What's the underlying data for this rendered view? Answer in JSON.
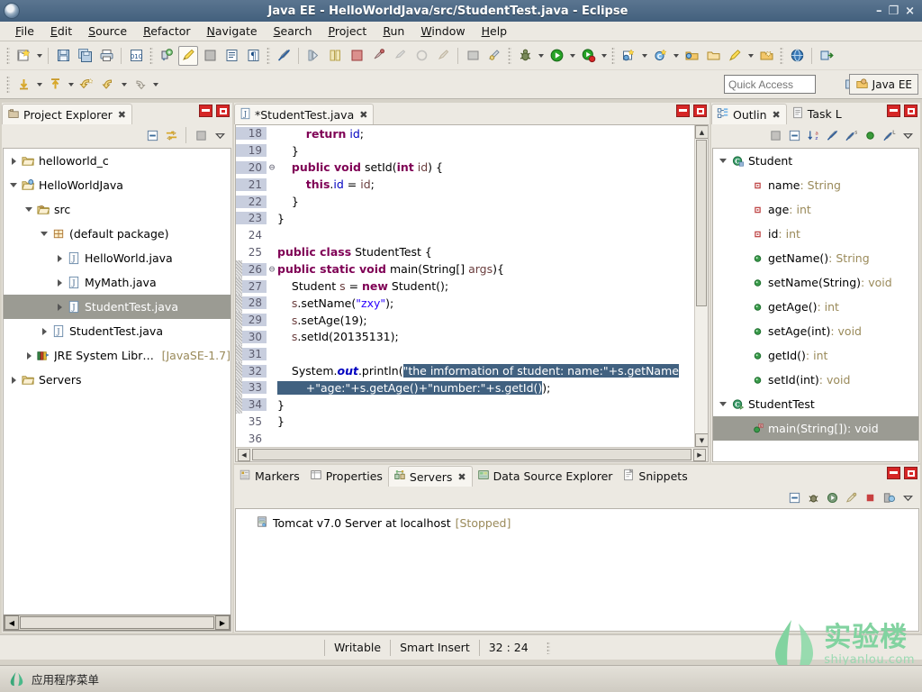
{
  "window": {
    "title": "Java EE - HelloWorldJava/src/StudentTest.java - Eclipse",
    "minimize": "–",
    "restore": "❐",
    "close": "×",
    "app_icon": "eclipse-icon"
  },
  "menubar": {
    "items": [
      {
        "label": "File"
      },
      {
        "label": "Edit"
      },
      {
        "label": "Source"
      },
      {
        "label": "Refactor"
      },
      {
        "label": "Navigate"
      },
      {
        "label": "Search"
      },
      {
        "label": "Project"
      },
      {
        "label": "Run"
      },
      {
        "label": "Window"
      },
      {
        "label": "Help"
      }
    ]
  },
  "toolbar": {
    "quick_access_placeholder": "Quick Access",
    "perspective_label": "Java EE",
    "open_perspective_icon": "open-perspective-icon",
    "row1_icons": [
      "new-wizard-icon",
      "new-dropdown-icon",
      "save-icon",
      "save-all-icon",
      "print-icon",
      "toggle-breadcrumb-icon",
      "new-jsp-icon",
      "link-icon",
      "markers-icon",
      "show-whitespace-icon",
      "paragraph-icon",
      "skip-breakpoints-icon",
      "step-icon",
      "toggle-icon",
      "block-icon",
      "search-icon",
      "history-icon",
      "refresh-icon",
      "open-type-icon",
      "open-task-icon",
      "debug-icon",
      "run-icon",
      "run-last-icon",
      "new-java-project-icon",
      "new-class-icon",
      "open-folder-icon",
      "open-resource-icon",
      "pin-icon",
      "external-tools-icon",
      "web-browser-icon",
      "deploy-icon"
    ],
    "row2_icons": [
      "next-annotation-icon",
      "previous-annotation-icon",
      "back-icon",
      "forward-icon",
      "last-edit-icon"
    ]
  },
  "project_explorer": {
    "tab_label": "Project Explorer",
    "tab_icon": "project-explorer-icon",
    "close_glyph": "✖",
    "toolbar_icons": [
      "collapse-all-icon",
      "link-with-editor-icon",
      "view-menu-grid-icon",
      "view-menu-icon"
    ],
    "tree": [
      {
        "label": "helloworld_c",
        "indent": 0,
        "twisty": "collapsed",
        "icon": "project-folder-icon",
        "selected": false,
        "suffix": ""
      },
      {
        "label": "HelloWorldJava",
        "indent": 0,
        "twisty": "expanded",
        "icon": "java-project-icon",
        "selected": false,
        "suffix": ""
      },
      {
        "label": "src",
        "indent": 1,
        "twisty": "expanded",
        "icon": "source-folder-icon",
        "selected": false,
        "suffix": ""
      },
      {
        "label": "(default package)",
        "indent": 2,
        "twisty": "expanded",
        "icon": "package-icon",
        "selected": false,
        "suffix": ""
      },
      {
        "label": "HelloWorld.java",
        "indent": 3,
        "twisty": "collapsed",
        "icon": "java-file-icon",
        "selected": false,
        "suffix": ""
      },
      {
        "label": "MyMath.java",
        "indent": 3,
        "twisty": "collapsed",
        "icon": "java-file-icon",
        "selected": false,
        "suffix": ""
      },
      {
        "label": "StudentTest.java",
        "indent": 3,
        "twisty": "collapsed",
        "icon": "java-file-icon",
        "selected": true,
        "suffix": ""
      },
      {
        "label": "StudentTest.java",
        "indent": 2,
        "twisty": "collapsed",
        "icon": "java-file-icon",
        "selected": false,
        "suffix": ""
      },
      {
        "label": "JRE System Library",
        "indent": 1,
        "twisty": "collapsed",
        "icon": "jre-library-icon",
        "selected": false,
        "suffix": "[JavaSE-1.7]"
      },
      {
        "label": "Servers",
        "indent": 0,
        "twisty": "collapsed",
        "icon": "project-folder-icon",
        "selected": false,
        "suffix": ""
      }
    ]
  },
  "editor": {
    "tab_label": "*StudentTest.java",
    "tab_icon": "java-file-icon",
    "close_glyph": "✖",
    "first_line": 18,
    "lines": [
      {
        "n": 18,
        "fold": "",
        "marker": false,
        "ln_hl": true,
        "segs": [
          {
            "t": "        ",
            "c": "plain"
          },
          {
            "t": "return",
            "c": "kw"
          },
          {
            "t": " ",
            "c": "plain"
          },
          {
            "t": "id",
            "c": "fld"
          },
          {
            "t": ";",
            "c": "plain"
          }
        ]
      },
      {
        "n": 19,
        "fold": "",
        "marker": false,
        "ln_hl": true,
        "segs": [
          {
            "t": "    }",
            "c": "plain"
          }
        ]
      },
      {
        "n": 20,
        "fold": "⊖",
        "marker": false,
        "ln_hl": true,
        "segs": [
          {
            "t": "    ",
            "c": "plain"
          },
          {
            "t": "public void",
            "c": "kw"
          },
          {
            "t": " setId(",
            "c": "plain"
          },
          {
            "t": "int",
            "c": "kw"
          },
          {
            "t": " ",
            "c": "plain"
          },
          {
            "t": "id",
            "c": "var"
          },
          {
            "t": ") {",
            "c": "plain"
          }
        ]
      },
      {
        "n": 21,
        "fold": "",
        "marker": false,
        "ln_hl": true,
        "segs": [
          {
            "t": "        ",
            "c": "plain"
          },
          {
            "t": "this",
            "c": "kw"
          },
          {
            "t": ".",
            "c": "plain"
          },
          {
            "t": "id",
            "c": "fld"
          },
          {
            "t": " = ",
            "c": "plain"
          },
          {
            "t": "id",
            "c": "var"
          },
          {
            "t": ";",
            "c": "plain"
          }
        ]
      },
      {
        "n": 22,
        "fold": "",
        "marker": false,
        "ln_hl": true,
        "segs": [
          {
            "t": "    }",
            "c": "plain"
          }
        ]
      },
      {
        "n": 23,
        "fold": "",
        "marker": false,
        "ln_hl": true,
        "segs": [
          {
            "t": "}",
            "c": "plain"
          }
        ]
      },
      {
        "n": 24,
        "fold": "",
        "marker": false,
        "ln_hl": false,
        "segs": [
          {
            "t": "",
            "c": "plain"
          }
        ]
      },
      {
        "n": 25,
        "fold": "",
        "marker": false,
        "ln_hl": false,
        "segs": [
          {
            "t": "public class",
            "c": "kw"
          },
          {
            "t": " StudentTest {",
            "c": "plain"
          }
        ]
      },
      {
        "n": 26,
        "fold": "⊖",
        "marker": true,
        "ln_hl": true,
        "segs": [
          {
            "t": "public static void",
            "c": "kw"
          },
          {
            "t": " main(String[] ",
            "c": "plain"
          },
          {
            "t": "args",
            "c": "var"
          },
          {
            "t": "){",
            "c": "plain"
          }
        ]
      },
      {
        "n": 27,
        "fold": "",
        "marker": true,
        "ln_hl": true,
        "segs": [
          {
            "t": "    Student ",
            "c": "plain"
          },
          {
            "t": "s",
            "c": "var"
          },
          {
            "t": " = ",
            "c": "plain"
          },
          {
            "t": "new",
            "c": "kw"
          },
          {
            "t": " Student();",
            "c": "plain"
          }
        ]
      },
      {
        "n": 28,
        "fold": "",
        "marker": true,
        "ln_hl": true,
        "segs": [
          {
            "t": "    ",
            "c": "plain"
          },
          {
            "t": "s",
            "c": "var"
          },
          {
            "t": ".setName(",
            "c": "plain"
          },
          {
            "t": "\"zxy\"",
            "c": "str"
          },
          {
            "t": ");",
            "c": "plain"
          }
        ]
      },
      {
        "n": 29,
        "fold": "",
        "marker": true,
        "ln_hl": true,
        "segs": [
          {
            "t": "    ",
            "c": "plain"
          },
          {
            "t": "s",
            "c": "var"
          },
          {
            "t": ".setAge(19);",
            "c": "plain"
          }
        ]
      },
      {
        "n": 30,
        "fold": "",
        "marker": true,
        "ln_hl": true,
        "segs": [
          {
            "t": "    ",
            "c": "plain"
          },
          {
            "t": "s",
            "c": "var"
          },
          {
            "t": ".setId(20135131);",
            "c": "plain"
          }
        ]
      },
      {
        "n": 31,
        "fold": "",
        "marker": true,
        "ln_hl": true,
        "segs": [
          {
            "t": "",
            "c": "plain"
          }
        ]
      },
      {
        "n": 32,
        "fold": "",
        "marker": true,
        "ln_hl": true,
        "segs": [
          {
            "t": "    System.",
            "c": "plain"
          },
          {
            "t": "out",
            "c": "stat"
          },
          {
            "t": ".println(",
            "c": "plain"
          },
          {
            "t": "\"the imformation of student: name:\"+s.getName",
            "c": "sel-txt"
          }
        ]
      },
      {
        "n": 33,
        "fold": "",
        "marker": true,
        "ln_hl": true,
        "segs": [
          {
            "t": "        +\"age:\"+s.getAge()+\"number:\"+s.getId()",
            "c": "sel-txt"
          },
          {
            "t": ");",
            "c": "plain"
          }
        ]
      },
      {
        "n": 34,
        "fold": "",
        "marker": true,
        "ln_hl": true,
        "segs": [
          {
            "t": "}",
            "c": "plain"
          }
        ]
      },
      {
        "n": 35,
        "fold": "",
        "marker": false,
        "ln_hl": false,
        "segs": [
          {
            "t": "}",
            "c": "plain"
          }
        ]
      },
      {
        "n": 36,
        "fold": "",
        "marker": false,
        "ln_hl": false,
        "segs": [
          {
            "t": "",
            "c": "plain"
          }
        ]
      }
    ]
  },
  "outline": {
    "tabs": [
      {
        "label": "Outlin",
        "icon": "outline-icon",
        "selected": true,
        "close_glyph": "✖"
      },
      {
        "label": "Task L",
        "icon": "task-list-icon",
        "selected": false,
        "close_glyph": ""
      }
    ],
    "toolbar_icons": [
      "focus-icon",
      "collapse-all-icon",
      "sort-icon",
      "hide-fields-icon",
      "hide-static-icon",
      "hide-nonpublic-icon",
      "hide-local-icon",
      "view-menu-icon"
    ],
    "items": [
      {
        "name": "Student",
        "type": "",
        "indent": 0,
        "twisty": "expanded",
        "icon": "class-icon",
        "selected": false
      },
      {
        "name": "name",
        "type": " : String",
        "indent": 1,
        "twisty": "",
        "icon": "field-private-icon",
        "selected": false
      },
      {
        "name": "age",
        "type": " : int",
        "indent": 1,
        "twisty": "",
        "icon": "field-private-icon",
        "selected": false
      },
      {
        "name": "id",
        "type": " : int",
        "indent": 1,
        "twisty": "",
        "icon": "field-private-icon",
        "selected": false
      },
      {
        "name": "getName()",
        "type": " : String",
        "indent": 1,
        "twisty": "",
        "icon": "method-public-icon",
        "selected": false
      },
      {
        "name": "setName(String)",
        "type": " : void",
        "indent": 1,
        "twisty": "",
        "icon": "method-public-icon",
        "selected": false
      },
      {
        "name": "getAge()",
        "type": " : int",
        "indent": 1,
        "twisty": "",
        "icon": "method-public-icon",
        "selected": false
      },
      {
        "name": "setAge(int)",
        "type": " : void",
        "indent": 1,
        "twisty": "",
        "icon": "method-public-icon",
        "selected": false
      },
      {
        "name": "getId()",
        "type": " : int",
        "indent": 1,
        "twisty": "",
        "icon": "method-public-icon",
        "selected": false
      },
      {
        "name": "setId(int)",
        "type": " : void",
        "indent": 1,
        "twisty": "",
        "icon": "method-public-icon",
        "selected": false
      },
      {
        "name": "StudentTest",
        "type": "",
        "indent": 0,
        "twisty": "expanded",
        "icon": "class-public-icon",
        "selected": false
      },
      {
        "name": "main(String[])",
        "type": " : void",
        "indent": 1,
        "twisty": "",
        "icon": "method-static-icon",
        "selected": true
      }
    ]
  },
  "bottom_panel": {
    "tabs": [
      {
        "label": "Markers",
        "icon": "markers-icon",
        "selected": false,
        "close_glyph": ""
      },
      {
        "label": "Properties",
        "icon": "properties-icon",
        "selected": false,
        "close_glyph": ""
      },
      {
        "label": "Servers",
        "icon": "servers-icon",
        "selected": true,
        "close_glyph": "✖"
      },
      {
        "label": "Data Source Explorer",
        "icon": "data-source-icon",
        "selected": false,
        "close_glyph": ""
      },
      {
        "label": "Snippets",
        "icon": "snippets-icon",
        "selected": false,
        "close_glyph": ""
      }
    ],
    "toolbar_icons": [
      "collapse-all-icon",
      "debug-server-icon",
      "start-server-icon",
      "profile-server-icon",
      "stop-server-icon",
      "publish-server-icon",
      "view-menu-icon"
    ],
    "servers": [
      {
        "name": "Tomcat v7.0 Server at localhost",
        "state": "[Stopped]",
        "icon": "server-icon"
      }
    ]
  },
  "statusbar": {
    "writable": "Writable",
    "insert_mode": "Smart Insert",
    "position": "32 : 24"
  },
  "taskbar": {
    "app_menu_label": "应用程序菜单",
    "app_menu_icon": "shiyanlou-logo-icon"
  },
  "watermark": {
    "cn": "实验楼",
    "en": "shiyanlou.com",
    "icon": "shiyanlou-leaf-icon",
    "color": "#82d3a0"
  },
  "colors": {
    "titlebar": "#4a6480",
    "chrome": "#ece9e2",
    "selection": "#416180",
    "tree_selection": "#9b9b93",
    "keyword": "#7f0055",
    "string": "#2a00ff",
    "field": "#0000c0",
    "type_suffix": "#9a8a5a",
    "close_button": "#d62626"
  }
}
